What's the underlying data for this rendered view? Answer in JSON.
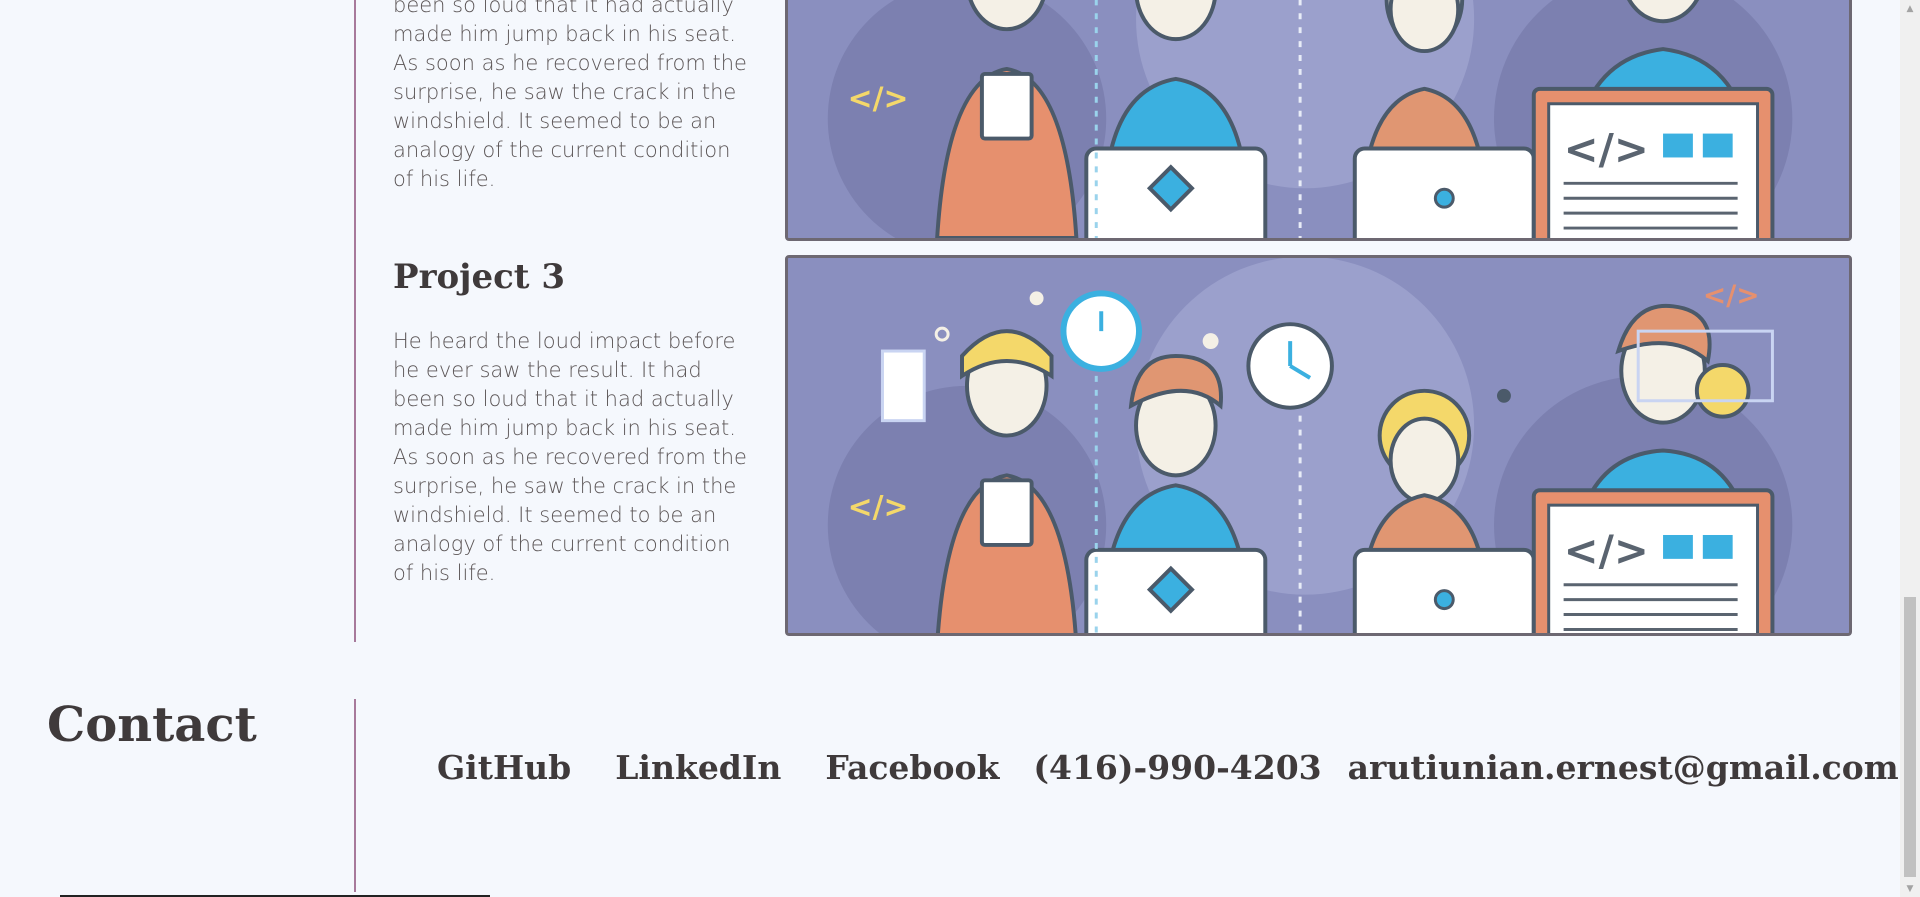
{
  "projects": [
    {
      "title": "",
      "description": "been so loud that it had actually made him jump back in his seat. As soon as he recovered from the surprise, he saw the crack in the windshield. It seemed to be an analogy of the current condition of his life."
    },
    {
      "title": "Project 3",
      "description": "He heard the loud impact before he ever saw the result. It had been so loud that it had actually made him jump back in his seat. As soon as he recovered from the surprise, he saw the crack in the windshield. It seemed to be an analogy of the current condition of his life."
    }
  ],
  "contact": {
    "heading": "Contact",
    "links": {
      "github": "GitHub",
      "linkedin": "LinkedIn",
      "facebook": "Facebook",
      "phone": "(416)-990-4203",
      "email": "arutiunian.ernest@gmail.com"
    }
  },
  "colors": {
    "background": "#f5f8fd",
    "accent_divider": "#a77a9b",
    "illustration_bg": "#8a8fbf",
    "text": "#3f3a3b"
  }
}
